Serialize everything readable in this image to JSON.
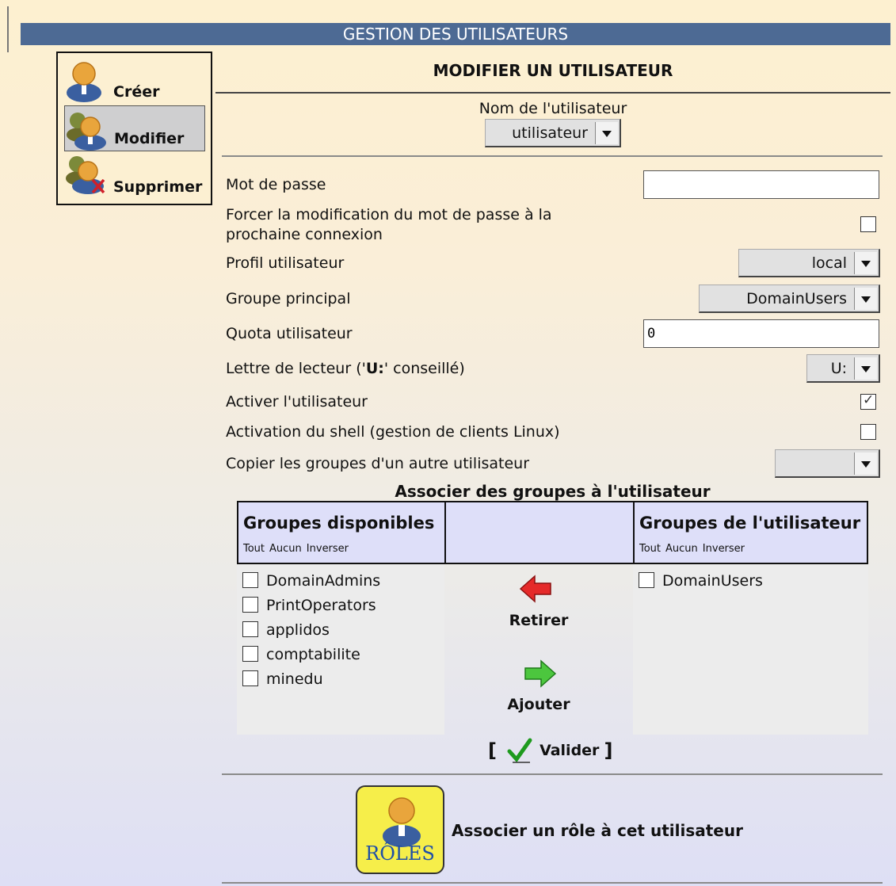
{
  "banner": {
    "title": "GESTION DES UTILISATEURS"
  },
  "sidemenu": {
    "items": [
      {
        "label": "Créer",
        "icon": "user-icon"
      },
      {
        "label": "Modifier",
        "icon": "users-icon",
        "selected": true
      },
      {
        "label": "Supprimer",
        "icon": "delete-user-icon"
      }
    ]
  },
  "main": {
    "title": "MODIFIER UN UTILISATEUR",
    "username_label": "Nom de l'utilisateur",
    "username_value": "utilisateur"
  },
  "form": {
    "password_label": "Mot de passe",
    "password_value": "",
    "force_change_label_1": "Forcer la modification du mot de passe à la",
    "force_change_label_2": "prochaine connexion",
    "force_change_checked": false,
    "profile_label": "Profil utilisateur",
    "profile_value": "local",
    "group_label": "Groupe principal",
    "group_value": "DomainUsers",
    "quota_label": "Quota utilisateur",
    "quota_value": "0",
    "drive_label_prefix": "Lettre de lecteur ('",
    "drive_label_bold": "U:",
    "drive_label_suffix": "' conseillé)",
    "drive_value": "U:",
    "activate_label": "Activer l'utilisateur",
    "activate_checked": true,
    "shell_label": "Activation du shell (gestion de clients Linux)",
    "shell_checked": false,
    "copy_groups_label": "Copier les groupes d'un autre utilisateur",
    "copy_groups_value": ""
  },
  "groups": {
    "title": "Associer des groupes à l'utilisateur",
    "available_title": "Groupes disponibles",
    "user_title": "Groupes de l'utilisateur",
    "link_all": "Tout",
    "link_none": "Aucun",
    "link_invert": "Inverser",
    "available": [
      "DomainAdmins",
      "PrintOperators",
      "applidos",
      "comptabilite",
      "minedu"
    ],
    "assigned": [
      "DomainUsers"
    ],
    "remove_label": "Retirer",
    "add_label": "Ajouter"
  },
  "validate": {
    "open": "[",
    "label": "Valider",
    "close": "]"
  },
  "roles": {
    "icon_text": "RÔLES",
    "label": "Associer un rôle à cet utilisateur"
  },
  "colors": {
    "banner": "#4d6a94",
    "header_bg": "#dedff9",
    "roles_bg": "#f6ee4a"
  }
}
